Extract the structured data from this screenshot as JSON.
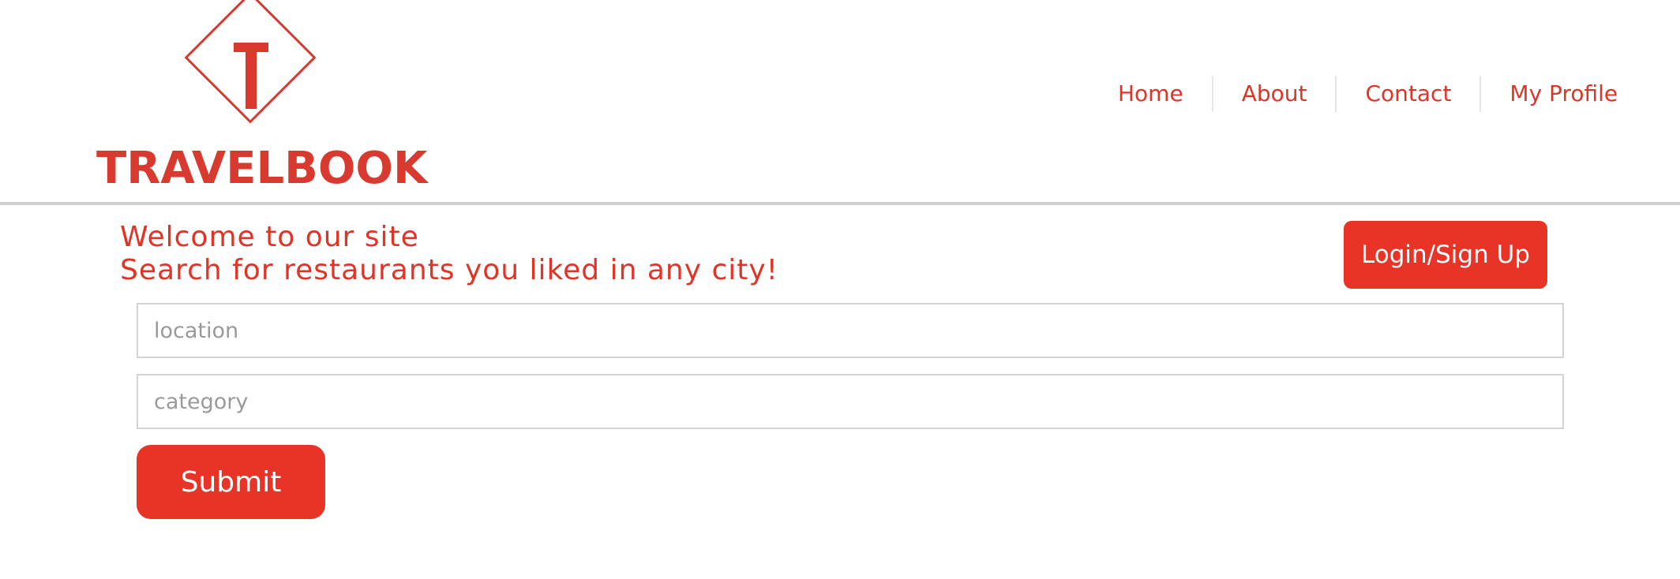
{
  "logo": {
    "wordmark": "TRAVELBOOK",
    "icon": "t-diamond-logo-icon"
  },
  "nav": {
    "items": [
      "Home",
      "About",
      "Contact",
      "My Profile"
    ]
  },
  "welcome": {
    "line1": "Welcome to our site",
    "line2": "Search for restaurants you liked in any city!"
  },
  "auth": {
    "login_label": "Login/Sign Up"
  },
  "search": {
    "location_placeholder": "location",
    "location_value": "",
    "category_placeholder": "category",
    "category_value": "",
    "submit_label": "Submit"
  },
  "colors": {
    "brand_red": "#e83327",
    "logo_red": "#d83a2f",
    "border_gray": "#cfcfcf",
    "placeholder_gray": "#9a9a9a"
  }
}
